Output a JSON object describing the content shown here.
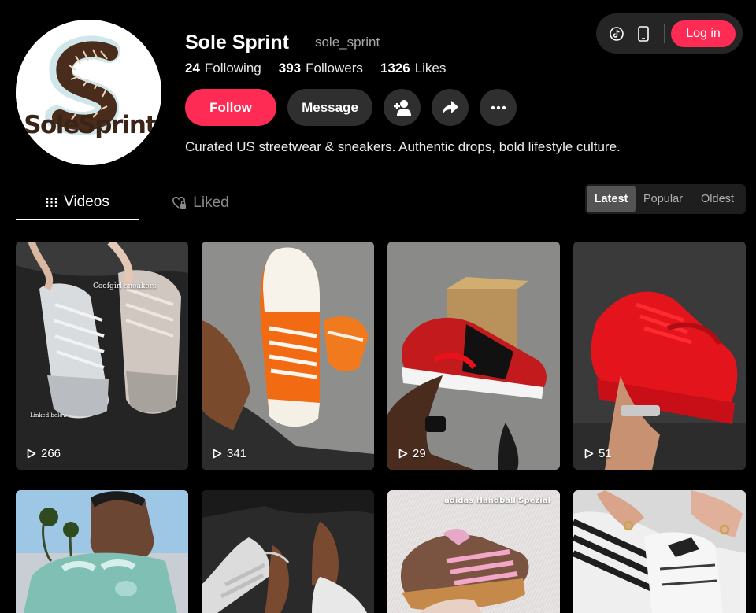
{
  "profile": {
    "logo_text": "SoleSprint",
    "display_name": "Sole Sprint",
    "handle": "sole_sprint",
    "bio": "Curated US streetwear & sneakers. Authentic drops, bold lifestyle culture."
  },
  "stats": [
    {
      "value": "24",
      "label": "Following"
    },
    {
      "value": "393",
      "label": "Followers"
    },
    {
      "value": "1326",
      "label": "Likes"
    }
  ],
  "actions": {
    "follow_label": "Follow",
    "message_label": "Message",
    "icons": [
      "add-friend-icon",
      "share-icon",
      "more-icon"
    ]
  },
  "topbar": {
    "icons": [
      "tiktok-icon",
      "phone-icon"
    ],
    "login_label": "Log in"
  },
  "tabs": [
    {
      "label": "Videos",
      "icon": "grid-icon",
      "active": true
    },
    {
      "label": "Liked",
      "icon": "heart-lock-icon",
      "active": false
    }
  ],
  "sort": {
    "options": [
      "Latest",
      "Popular",
      "Oldest"
    ],
    "selected": "Latest"
  },
  "videos": [
    {
      "views": "266",
      "overlay_top": "Coofgirl sneakers",
      "overlay_bottom": "Linked below"
    },
    {
      "views": "341"
    },
    {
      "views": "29"
    },
    {
      "views": "51"
    },
    {
      "views": ""
    },
    {
      "views": ""
    },
    {
      "views": "",
      "overlay_top": "adidas Handball Spezial"
    },
    {
      "views": ""
    }
  ],
  "colors": {
    "accent": "#fe2c55",
    "background": "#000000",
    "button_dark": "#2f2f2f"
  }
}
